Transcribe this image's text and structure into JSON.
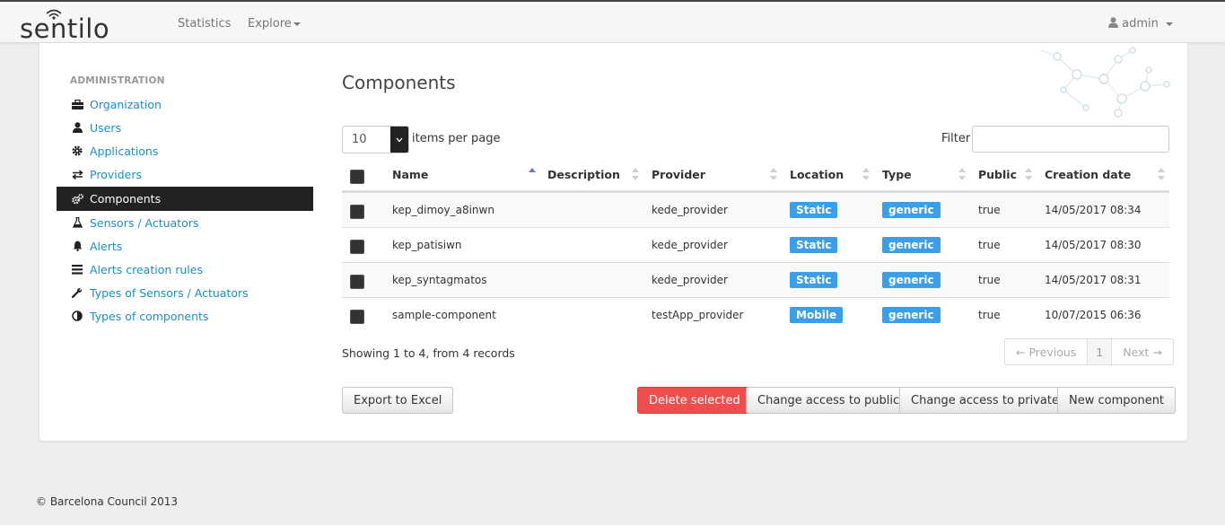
{
  "header": {
    "brand": "sentilo",
    "nav": [
      {
        "label": "Statistics"
      },
      {
        "label": "Explore"
      }
    ],
    "user": "admin"
  },
  "sidebar": {
    "heading": "ADMINISTRATION",
    "items": [
      {
        "label": "Organization",
        "icon": "briefcase-icon"
      },
      {
        "label": "Users",
        "icon": "user-icon"
      },
      {
        "label": "Applications",
        "icon": "cog-icon"
      },
      {
        "label": "Providers",
        "icon": "transfer-icon"
      },
      {
        "label": "Components",
        "icon": "cogs-icon",
        "active": true
      },
      {
        "label": "Sensors / Actuators",
        "icon": "flask-icon"
      },
      {
        "label": "Alerts",
        "icon": "bell-icon"
      },
      {
        "label": "Alerts creation rules",
        "icon": "list-icon"
      },
      {
        "label": "Types of Sensors / Actuators",
        "icon": "wrench-icon"
      },
      {
        "label": "Types of components",
        "icon": "adjust-icon"
      }
    ]
  },
  "main": {
    "title": "Components",
    "per_page_value": "10",
    "per_page_label": "items per page",
    "filter_label": "Filter",
    "filter_value": "",
    "columns": [
      "Name",
      "Description",
      "Provider",
      "Location",
      "Type",
      "Public",
      "Creation date"
    ],
    "rows": [
      {
        "name": "kep_dimoy_a8inwn",
        "description": "",
        "provider": "kede_provider",
        "location": "Static",
        "type": "generic",
        "public": "true",
        "created": "14/05/2017 08:34"
      },
      {
        "name": "kep_patisiwn",
        "description": "",
        "provider": "kede_provider",
        "location": "Static",
        "type": "generic",
        "public": "true",
        "created": "14/05/2017 08:30"
      },
      {
        "name": "kep_syntagmatos",
        "description": "",
        "provider": "kede_provider",
        "location": "Static",
        "type": "generic",
        "public": "true",
        "created": "14/05/2017 08:31"
      },
      {
        "name": "sample-component",
        "description": "",
        "provider": "testApp_provider",
        "location": "Mobile",
        "type": "generic",
        "public": "true",
        "created": "10/07/2015 06:36"
      }
    ],
    "showing": "Showing 1 to 4, from 4 records",
    "pager": {
      "prev": "← Previous",
      "page": "1",
      "next": "Next →"
    },
    "buttons": {
      "export": "Export to Excel",
      "delete": "Delete selected",
      "public": "Change access to public",
      "private": "Change access to private",
      "new": "New component"
    }
  },
  "footer": "© Barcelona Council 2013",
  "colors": {
    "accent": "#1a8fc8",
    "badge": "#3a9ee8",
    "danger": "#f04d4e",
    "active": "#222222"
  }
}
